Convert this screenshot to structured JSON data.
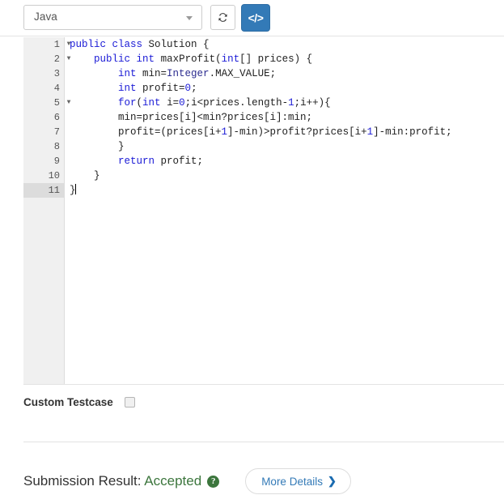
{
  "toolbar": {
    "language_select": {
      "value": "Java",
      "icon": "chevron-down-icon"
    },
    "refresh_button": {
      "icon": "refresh-icon",
      "title": "Reset to default code"
    },
    "code_button": {
      "icon": "code-icon",
      "glyph": "</>",
      "color": "#337ab7",
      "title": "Toggle full screen code editor"
    }
  },
  "editor": {
    "active_line": 11,
    "line_numbers": [
      "1",
      "2",
      "3",
      "4",
      "5",
      "6",
      "7",
      "8",
      "9",
      "10",
      "11"
    ],
    "fold_markers": [
      1,
      2,
      5
    ],
    "lines": [
      {
        "n": "1",
        "tokens": [
          {
            "t": "kw",
            "v": "public"
          },
          {
            "t": "p",
            "v": " "
          },
          {
            "t": "kw",
            "v": "class"
          },
          {
            "t": "p",
            "v": " Solution {"
          }
        ]
      },
      {
        "n": "2",
        "tokens": [
          {
            "t": "p",
            "v": "    "
          },
          {
            "t": "kw",
            "v": "public"
          },
          {
            "t": "p",
            "v": " "
          },
          {
            "t": "kw",
            "v": "int"
          },
          {
            "t": "p",
            "v": " maxProfit("
          },
          {
            "t": "kw",
            "v": "int"
          },
          {
            "t": "p",
            "v": "[] prices) {"
          }
        ]
      },
      {
        "n": "3",
        "tokens": [
          {
            "t": "p",
            "v": "        "
          },
          {
            "t": "kw",
            "v": "int"
          },
          {
            "t": "p",
            "v": " min="
          },
          {
            "t": "typ",
            "v": "Integer"
          },
          {
            "t": "p",
            "v": ".MAX_VALUE;"
          }
        ]
      },
      {
        "n": "4",
        "tokens": [
          {
            "t": "p",
            "v": "        "
          },
          {
            "t": "kw",
            "v": "int"
          },
          {
            "t": "p",
            "v": " profit="
          },
          {
            "t": "num",
            "v": "0"
          },
          {
            "t": "p",
            "v": ";"
          }
        ]
      },
      {
        "n": "5",
        "tokens": [
          {
            "t": "p",
            "v": "        "
          },
          {
            "t": "kw",
            "v": "for"
          },
          {
            "t": "p",
            "v": "("
          },
          {
            "t": "kw",
            "v": "int"
          },
          {
            "t": "p",
            "v": " i="
          },
          {
            "t": "num",
            "v": "0"
          },
          {
            "t": "p",
            "v": ";i<prices.length-"
          },
          {
            "t": "num",
            "v": "1"
          },
          {
            "t": "p",
            "v": ";i++){"
          }
        ]
      },
      {
        "n": "6",
        "tokens": [
          {
            "t": "p",
            "v": "        min=prices[i]<min?prices[i]:min;"
          }
        ]
      },
      {
        "n": "7",
        "tokens": [
          {
            "t": "p",
            "v": "        profit=(prices[i+"
          },
          {
            "t": "num",
            "v": "1"
          },
          {
            "t": "p",
            "v": "]-min)>profit?prices[i+"
          },
          {
            "t": "num",
            "v": "1"
          },
          {
            "t": "p",
            "v": "]-min:profit;"
          }
        ]
      },
      {
        "n": "8",
        "tokens": [
          {
            "t": "p",
            "v": "        }"
          }
        ]
      },
      {
        "n": "9",
        "tokens": [
          {
            "t": "p",
            "v": "        "
          },
          {
            "t": "kw",
            "v": "return"
          },
          {
            "t": "p",
            "v": " profit;"
          }
        ]
      },
      {
        "n": "10",
        "tokens": [
          {
            "t": "p",
            "v": "    }"
          }
        ]
      },
      {
        "n": "11",
        "tokens": [
          {
            "t": "p",
            "v": "}"
          }
        ],
        "cursor": true
      }
    ],
    "plain_text": "public class Solution {\n    public int maxProfit(int[] prices) {\n        int min=Integer.MAX_VALUE;\n        int profit=0;\n        for(int i=0;i<prices.length-1;i++){\n        min=prices[i]<min?prices[i]:min;\n        profit=(prices[i+1]-min)>profit?prices[i+1]-min:profit;\n        }\n        return profit;\n    }\n}"
  },
  "custom_testcase": {
    "label": "Custom Testcase",
    "checked": false
  },
  "submission": {
    "label": "Submission Result: ",
    "status": "Accepted",
    "status_color": "#3c763d",
    "help_icon_glyph": "?",
    "more_details_label": "More Details",
    "more_details_chevron": "❯"
  }
}
